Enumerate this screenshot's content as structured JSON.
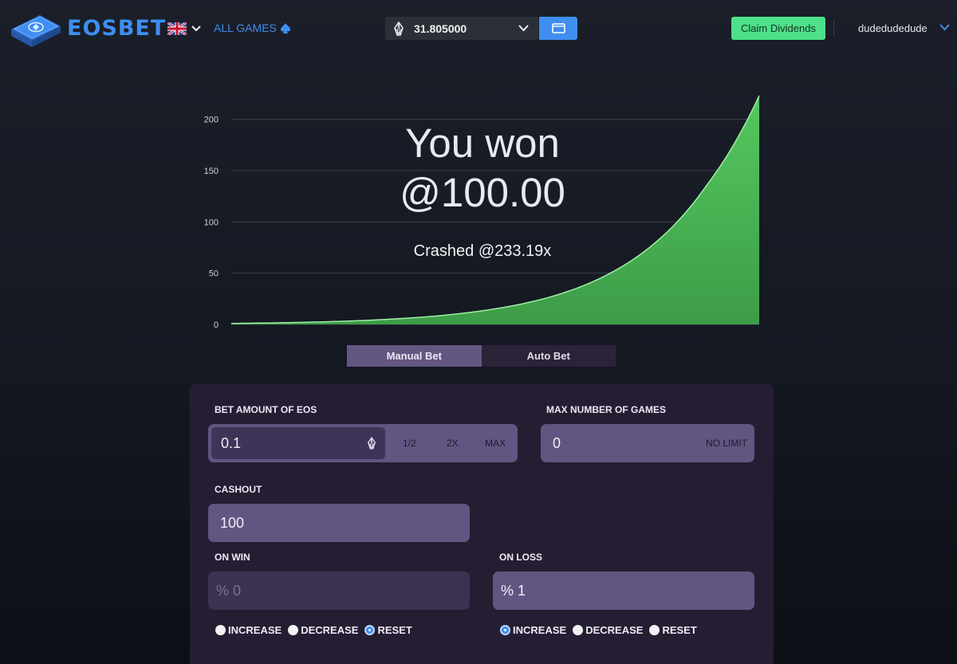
{
  "header": {
    "brand": "EOSBET",
    "language_icon": "uk-flag-icon",
    "all_games_label": "ALL GAMES",
    "wallet_balance": "31.805000",
    "claim_label": "Claim Dividends",
    "username": "dudedudedude"
  },
  "result": {
    "line1": "You won",
    "line2": "@100.00",
    "crashed": "Crashed @233.19x"
  },
  "chart_data": {
    "type": "area",
    "title": "",
    "xlabel": "",
    "ylabel": "",
    "ylim": [
      0,
      223
    ],
    "y_ticks": [
      "0",
      "50",
      "100",
      "150",
      "200"
    ],
    "x": [
      0,
      10,
      20,
      30,
      40,
      50,
      60,
      70,
      80,
      90,
      100
    ],
    "values": [
      1,
      1.7,
      2.9,
      5.1,
      8.8,
      15.2,
      26.2,
      45.3,
      78.3,
      135.3,
      223
    ],
    "series_color": "#4fc15a",
    "grid": true
  },
  "tabs": [
    {
      "label": "Manual Bet",
      "active": true
    },
    {
      "label": "Auto Bet",
      "active": false
    }
  ],
  "form": {
    "bet_label": "BET AMOUNT OF EOS",
    "bet_value": "0.1",
    "bet_half": "1/2",
    "bet_double": "2X",
    "bet_max": "MAX",
    "max_games_label": "MAX NUMBER OF GAMES",
    "max_games_value": "0",
    "no_limit": "NO LIMIT",
    "cashout_label": "CASHOUT",
    "cashout_value": "100",
    "on_win_label": "ON WIN",
    "on_win_value": "% 0",
    "on_loss_label": "ON LOSS",
    "on_loss_value": "% 1",
    "on_win_options": [
      {
        "label": "INCREASE",
        "selected": false
      },
      {
        "label": "DECREASE",
        "selected": false
      },
      {
        "label": "RESET",
        "selected": true
      }
    ],
    "on_loss_options": [
      {
        "label": "INCREASE",
        "selected": true
      },
      {
        "label": "DECREASE",
        "selected": false
      },
      {
        "label": "RESET",
        "selected": false
      }
    ]
  },
  "colors": {
    "accent": "#3f8ef0",
    "claim": "#4ee08a",
    "panel": "#251e33",
    "field": "#625582"
  }
}
